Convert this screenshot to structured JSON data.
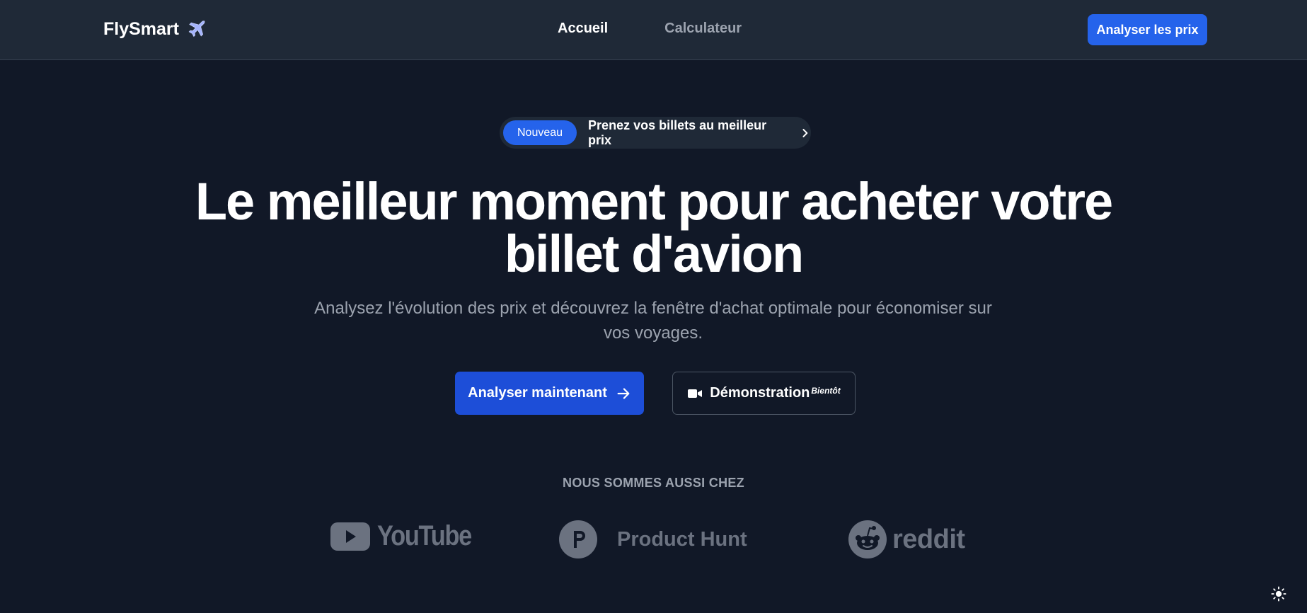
{
  "nav": {
    "logo_text": "FlySmart",
    "logo_icon": "airplane-icon",
    "links": [
      {
        "label": "Accueil",
        "active": true
      },
      {
        "label": "Calculateur",
        "active": false
      }
    ],
    "cta_label": "Analyser les prix"
  },
  "announcement": {
    "badge": "Nouveau",
    "text": "Prenez vos billets au meilleur prix",
    "icon": "chevron-right-icon"
  },
  "hero": {
    "title_line1": "Le meilleur moment pour acheter votre",
    "title_line2": "billet d'avion",
    "subtitle_line1": "Analysez l'évolution des prix et découvrez la fenêtre d'achat optimale pour économiser sur",
    "subtitle_line2": "vos voyages.",
    "primary_button": "Analyser maintenant",
    "primary_icon": "arrow-right-icon",
    "secondary_button": "Démonstration",
    "secondary_icon": "video-camera-icon",
    "secondary_tag": "Bientôt"
  },
  "partners": {
    "label": "NOUS SOMMES AUSSI CHEZ",
    "items": [
      {
        "name": "YouTube",
        "icon": "youtube-icon"
      },
      {
        "name": "Product Hunt",
        "icon": "product-hunt-icon"
      },
      {
        "name": "reddit",
        "icon": "reddit-icon"
      }
    ]
  },
  "theme_toggle_icon": "sun-icon",
  "colors": {
    "background": "#111827",
    "navbar": "#1f2937",
    "accent": "#2563eb",
    "muted_text": "#9ca3af",
    "logo_muted": "#6b7280"
  }
}
